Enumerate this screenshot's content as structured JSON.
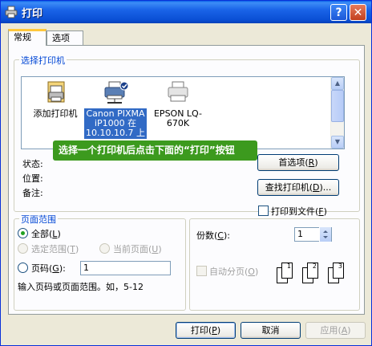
{
  "window": {
    "title": "打印"
  },
  "tabs": [
    {
      "label": "常规"
    },
    {
      "label": "选项"
    }
  ],
  "select_printer": {
    "legend": "选择打印机",
    "printers": [
      {
        "label": "添加打印机"
      },
      {
        "label": "Canon PIXMA iP1000 在 10.10.10.7 上",
        "selected": true
      },
      {
        "label": "EPSON LQ-670K"
      }
    ],
    "status_label": "状态:",
    "location_label": "位置:",
    "comment_label": "备注:",
    "tooltip": "选择一个打印机后点击下面的“打印”按钮",
    "preferences_button": "首选项",
    "preferences_key": "R",
    "find_button": "查找打印机",
    "find_key": "D",
    "print_to_file": "打印到文件",
    "print_to_file_key": "F"
  },
  "page_range": {
    "legend": "页面范围",
    "all": "全部",
    "all_key": "L",
    "selection": "选定范围",
    "selection_key": "T",
    "current": "当前页面",
    "current_key": "U",
    "pages": "页码",
    "pages_key": "G",
    "pages_value": "1",
    "hint": "输入页码或页面范围。如，5-12"
  },
  "copies": {
    "label": "份数",
    "key": "C",
    "value": "1",
    "collate": "自动分页",
    "collate_key": "O",
    "page_numbers": [
      "1",
      "1",
      "2",
      "2",
      "3",
      "3"
    ]
  },
  "footer": {
    "print": "打印",
    "print_key": "P",
    "cancel": "取消",
    "apply": "应用",
    "apply_key": "A"
  },
  "colors": {
    "title_bar": "#0a5fe8",
    "group_legend": "#0046d5",
    "tooltip": "#3c9a1e",
    "selection": "#316ac5"
  }
}
